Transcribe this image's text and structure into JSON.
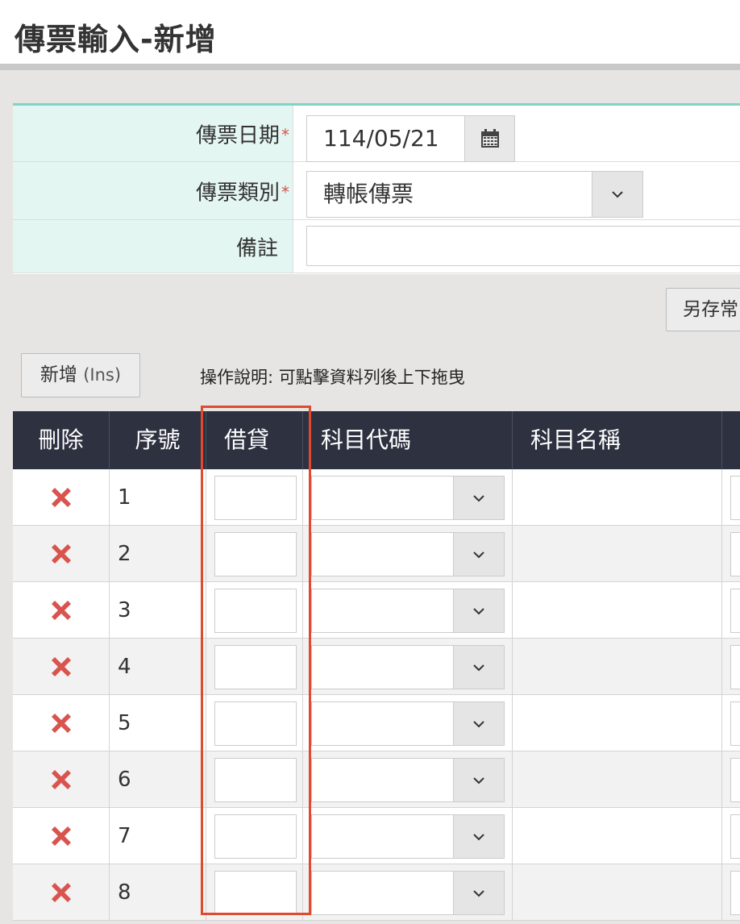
{
  "page": {
    "title": "傳票輸入-新增"
  },
  "form": {
    "date_label": "傳票日期",
    "date_value": "114/05/21",
    "type_label": "傳票類別",
    "type_value": "轉帳傳票",
    "note_label": "備註",
    "note_value": "",
    "required_mark": "*"
  },
  "toolbar": {
    "save_common_label": "另存常",
    "add_label": "新增",
    "add_shortcut": "(Ins)",
    "hint": "操作說明: 可點擊資料列後上下拖曳"
  },
  "grid": {
    "columns": [
      "刪除",
      "序號",
      "借貸",
      "科目代碼",
      "科目名稱"
    ],
    "rows": [
      {
        "seq": "1"
      },
      {
        "seq": "2"
      },
      {
        "seq": "3"
      },
      {
        "seq": "4"
      },
      {
        "seq": "5"
      },
      {
        "seq": "6"
      },
      {
        "seq": "7"
      },
      {
        "seq": "8"
      }
    ]
  },
  "colors": {
    "header_bg": "#2d3140",
    "label_bg": "#e4f6f1",
    "accent": "#7fd3c9",
    "delete": "#d9534f",
    "highlight": "#e04a2f"
  }
}
